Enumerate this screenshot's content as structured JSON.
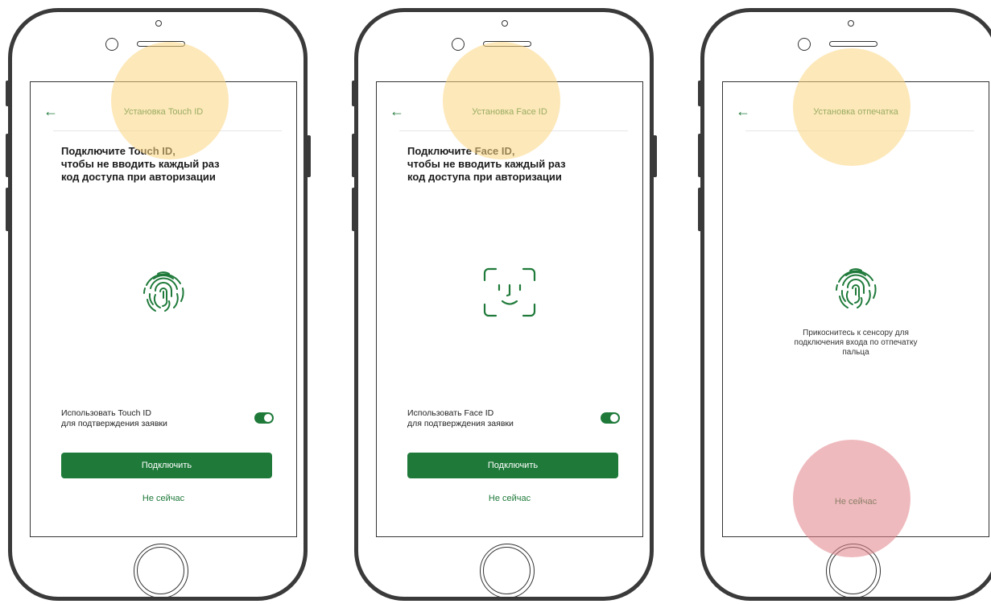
{
  "phones": [
    {
      "header_title": "Установка Touch ID",
      "heading": [
        "Подключите Touch ID,",
        "чтобы не вводить каждый раз",
        "код доступа при авторизации"
      ],
      "biometric_icon": "fingerprint-icon",
      "option_label": [
        "Использовать Touch ID",
        "для подтверждения заявки"
      ],
      "toggle_state": "on",
      "primary_button": "Подключить",
      "secondary_link": "Не сейчас"
    },
    {
      "header_title": "Установка Face ID",
      "heading": [
        "Подключите Face ID,",
        "чтобы не вводить каждый раз",
        "код доступа при авторизации"
      ],
      "biometric_icon": "face-id-icon",
      "option_label": [
        "Использовать Face ID",
        "для подтверждения заявки"
      ],
      "toggle_state": "on",
      "primary_button": "Подключить",
      "secondary_link": "Не сейчас"
    },
    {
      "header_title": "Установка отпечатка",
      "biometric_icon": "fingerprint-icon",
      "hint": [
        "Прикоснитесь к сенсору для",
        "подключения входа по отпечатку",
        "пальца"
      ],
      "secondary_link": "Не сейчас"
    }
  ],
  "back_icon": "arrow-left-icon",
  "colors": {
    "accent": "#1f7a3a",
    "highlight_yellow": "#fcd680",
    "highlight_red": "#e28288"
  }
}
